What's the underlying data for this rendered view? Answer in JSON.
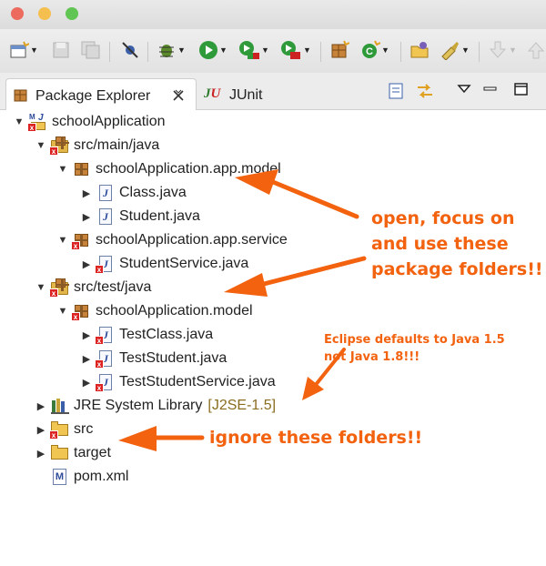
{
  "window": {
    "traffic_lights": [
      "#ed6a5e",
      "#f5bf4f",
      "#61c554"
    ]
  },
  "tabs": [
    {
      "label": "Package Explorer",
      "active": true
    },
    {
      "label": "JUnit",
      "active": false
    }
  ],
  "tree": {
    "project": "schoolApplication",
    "src_main": "src/main/java",
    "pkg_app_model": "schoolApplication.app.model",
    "file_class": "Class.java",
    "file_student": "Student.java",
    "pkg_app_service": "schoolApplication.app.service",
    "file_student_service": "StudentService.java",
    "src_test": "src/test/java",
    "pkg_model": "schoolApplication.model",
    "file_test_class": "TestClass.java",
    "file_test_student": "TestStudent.java",
    "file_test_student_service": "TestStudentService.java",
    "jre": "JRE System Library",
    "jre_version": "[J2SE-1.5]",
    "src": "src",
    "target": "target",
    "pom": "pom.xml"
  },
  "annotations": {
    "open_line1": "open, focus on",
    "open_line2": "and use these",
    "open_line3": "package folders!!",
    "eclipse_line1": "Eclipse defaults to Java 1.5",
    "eclipse_line2": "not Java 1.8!!!",
    "ignore": "ignore these folders!!"
  },
  "colors": {
    "annotation": "#f2620f",
    "jre_decoration": "#8a6d1f"
  }
}
